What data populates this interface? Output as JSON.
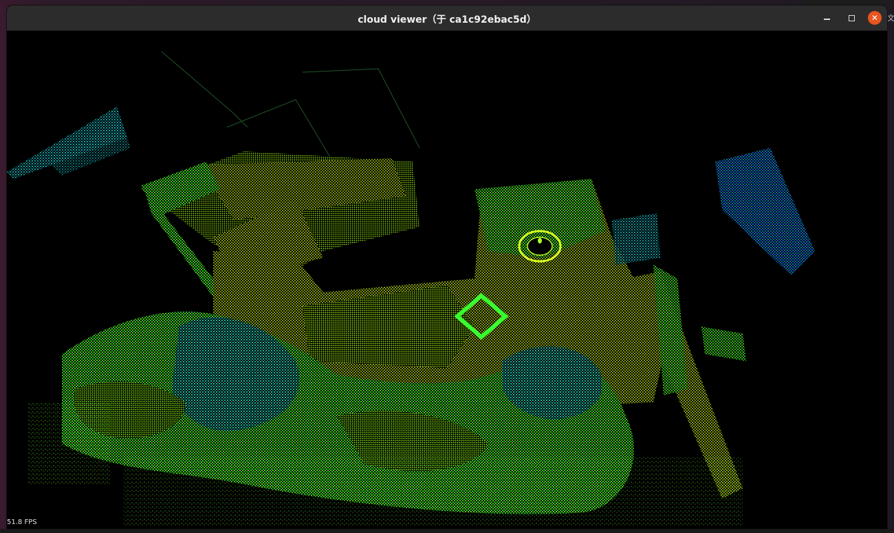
{
  "window": {
    "title": "cloud viewer（于 ca1c92ebac5d）",
    "minimize_icon": "minimize-icon",
    "maximize_icon": "maximize-icon",
    "close_icon": "close-icon"
  },
  "viewer": {
    "fps_text": "51.8 FPS",
    "colormap": [
      "#1a1aff",
      "#00e0ff",
      "#00ff66",
      "#66ff00",
      "#e6ff00",
      "#ffff00"
    ]
  },
  "desktop": {
    "side_glyph": "文"
  }
}
